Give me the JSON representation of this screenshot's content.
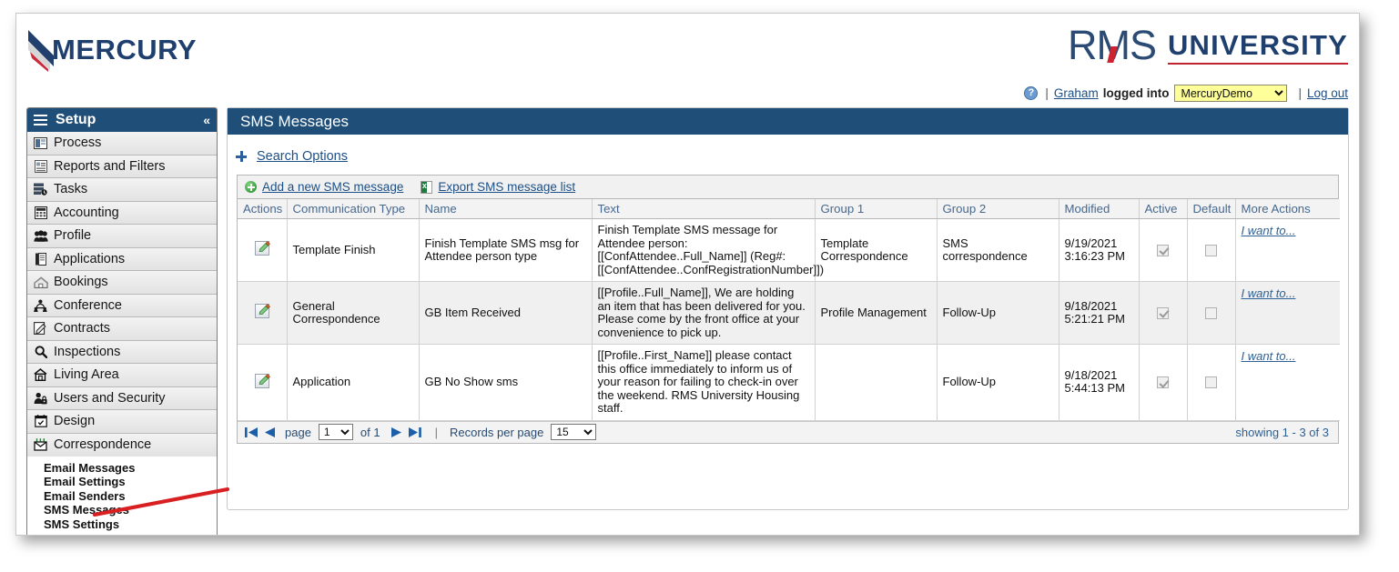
{
  "brand": {
    "mercury_wordmark": "MERCURY",
    "rms_mark": "RMS",
    "university_word": "UNIVERSITY"
  },
  "userbar": {
    "help_icon": "help-icon",
    "sep1": "|",
    "user_name": "Graham",
    "logged_into": "logged into",
    "database_selected": "MercuryDemo",
    "database_options": [
      "MercuryDemo"
    ],
    "sep2": "|",
    "logout": "Log out"
  },
  "sidebar": {
    "header": "Setup",
    "collapse_glyph": "«",
    "items": [
      {
        "label": "Process",
        "icon": "process-icon"
      },
      {
        "label": "Reports and Filters",
        "icon": "reports-icon"
      },
      {
        "label": "Tasks",
        "icon": "tasks-icon"
      },
      {
        "label": "Accounting",
        "icon": "accounting-icon"
      },
      {
        "label": "Profile",
        "icon": "profile-icon"
      },
      {
        "label": "Applications",
        "icon": "applications-icon"
      },
      {
        "label": "Bookings",
        "icon": "bookings-icon"
      },
      {
        "label": "Conference",
        "icon": "conference-icon"
      },
      {
        "label": "Contracts",
        "icon": "contracts-icon"
      },
      {
        "label": "Inspections",
        "icon": "inspections-icon"
      },
      {
        "label": "Living Area",
        "icon": "living-area-icon"
      },
      {
        "label": "Users and Security",
        "icon": "users-security-icon"
      },
      {
        "label": "Design",
        "icon": "design-icon"
      },
      {
        "label": "Correspondence",
        "icon": "correspondence-icon"
      }
    ],
    "submenu": [
      "Email Messages",
      "Email Settings",
      "Email Senders",
      "SMS Messages",
      "SMS Settings"
    ]
  },
  "main": {
    "title": "SMS Messages",
    "search_options": "Search Options",
    "toolbar": {
      "add_label": "Add a new SMS message",
      "export_label": "Export SMS message list"
    },
    "columns": [
      "Actions",
      "Communication Type",
      "Name",
      "Text",
      "Group 1",
      "Group 2",
      "Modified",
      "Active",
      "Default",
      "More Actions"
    ],
    "rows": [
      {
        "action_icon": "edit-icon",
        "communication_type": "Template Finish",
        "name": "Finish Template SMS msg for Attendee person type",
        "text": "Finish Template SMS message for Attendee person:[[ConfAttendee..Full_Name]] (Reg#:[[ConfAttendee..ConfRegistrationNumber]])",
        "group1": "Template Correspondence",
        "group2": "SMS correspondence",
        "modified": "9/19/2021 3:16:23 PM",
        "active": true,
        "default": false,
        "more_actions": "I want to..."
      },
      {
        "action_icon": "edit-icon",
        "communication_type": "General Correspondence",
        "name": "GB Item Received",
        "text": "[[Profile..Full_Name]], We are holding an item that has been delivered for you. Please come by the front office at your convenience to pick up.",
        "group1": "Profile Management",
        "group2": "Follow-Up",
        "modified": "9/18/2021 5:21:21 PM",
        "active": true,
        "default": false,
        "more_actions": "I want to..."
      },
      {
        "action_icon": "edit-icon",
        "communication_type": "Application",
        "name": "GB No Show sms",
        "text": "[[Profile..First_Name]] please contact this office immediately to inform us of your reason for failing to check-in over the weekend. RMS University Housing staff.",
        "group1": "",
        "group2": "Follow-Up",
        "modified": "9/18/2021 5:44:13 PM",
        "active": true,
        "default": false,
        "more_actions": "I want to..."
      }
    ],
    "pager": {
      "first_icon": "first-page-icon",
      "prev_icon": "previous-page-icon",
      "page_label": "page",
      "page_value": "1",
      "page_options": [
        "1"
      ],
      "of_label": "of 1",
      "next_icon": "next-page-icon",
      "last_icon": "last-page-icon",
      "divider": "|",
      "records_label": "Records per page",
      "records_value": "15",
      "records_options": [
        "15"
      ],
      "showing": "showing 1 - 3 of 3"
    }
  },
  "colors": {
    "header_blue": "#1f4e79",
    "link_blue": "#1b4f87",
    "accent_red": "#c0252f",
    "annotation_red": "#d81f22",
    "highlight_yellow": "#ffff99"
  }
}
